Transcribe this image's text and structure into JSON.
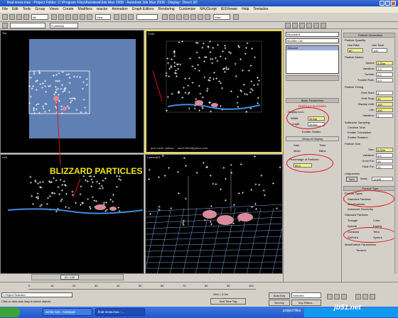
{
  "titlebar": {
    "text": "final-snow.max - Project Folder: C:\\Program Files\\Autodesk\\3ds Max 2008 - Autodesk 3ds Max 2008 - Display : Direct 3D"
  },
  "menubar": {
    "items": [
      "File",
      "Edit",
      "Tools",
      "Group",
      "Views",
      "Create",
      "Modifiers",
      "reactor",
      "Animation",
      "Graph Editors",
      "Rendering",
      "Customize",
      "MAXScript",
      "IESViewer",
      "Help",
      "Tentacles"
    ]
  },
  "toolbar": {
    "selection_filter": "All",
    "view_combo": "View",
    "named_sel": "0 (default)"
  },
  "viewports": {
    "top": {
      "label": "Top"
    },
    "front": {
      "label": "Front"
    },
    "left": {
      "label": "Left"
    },
    "camera": {
      "label": "Camera01"
    },
    "front_credit": "arch coral...pdisco...  .samt.2002@yahoo.com"
  },
  "overlay": {
    "title": "BLIZZARD PARTICLES"
  },
  "panel": {
    "object_name": "Blizzard01",
    "modifier_list": "Modifier List",
    "stack_item": "Blizzard",
    "basic_params": "Basic Parameters",
    "basic_title": "PARTICLE BLIZZARD",
    "display_icon": "Display Icon:",
    "width_label": "Width:",
    "width_val": "26.6m",
    "length_label": "Length:",
    "length_val": "26.6m",
    "emitter_hidden": "Emitter Hidden",
    "viewport_display": "Viewport Display",
    "dots": "Dots",
    "ticks": "Ticks",
    "mesh": "Mesh",
    "bbox": "BBox",
    "pct_label": "Percentage of Particles:",
    "pct_val": "50.0"
  },
  "panel2": {
    "particle_generation": "Particle Generation",
    "particle_quantity": "Particle Quantity",
    "use_rate": "Use Rate",
    "use_total": "Use Total",
    "rate_val": "80",
    "total_val": "100",
    "particle_motion": "Particle Motion",
    "speed": "Speed:",
    "speed_val": "0.25m",
    "variation": "Variation:",
    "variation_val": "2.0",
    "tumble": "Tumble:",
    "tumble_val": "0.0",
    "tumble_rate": "Tumble Rate:",
    "tumble_rate_val": "0.0",
    "particle_timing": "Particle Timing",
    "emit_start": "Emit Start:",
    "emit_start_val": "0",
    "emit_stop": "Emit Stop:",
    "emit_stop_val": "30",
    "display_until": "Display Until:",
    "display_until_val": "100",
    "life": "Life:",
    "life_val": "100",
    "var2": "Variation:",
    "var2_val": "0",
    "subframe": "Subframe Sampling:",
    "creation_time": "Creation Time",
    "emitter_translation": "Emitter Translation",
    "emitter_rotation": "Emitter Rotation",
    "particle_size": "Particle Size",
    "size": "Size:",
    "size_val": "0.02m",
    "var3": "Variation:",
    "var3_val": "0.0",
    "grow_for": "Grow For:",
    "grow_for_val": "10",
    "fade_for": "Fade For:",
    "fade_for_val": "10",
    "uniqueness": "Uniqueness",
    "new": "New",
    "seed": "Seed:",
    "seed_val": "12345",
    "particle_type": "Particle Type",
    "particle_types": "Particle Types",
    "standard": "Standard Particles",
    "metaparticles": "MetaParticles",
    "instanced": "Instanced Geometry",
    "standard_particles": "Standard Particles",
    "triangle": "Triangle",
    "cube": "Cube",
    "special": "Special",
    "facing": "Facing",
    "constant": "Constant",
    "tetra": "Tetra",
    "sixpoint": "SixPoint",
    "sphere": "Sphere",
    "meta_params": "MetaParticle Parameters",
    "tension": "Tension:"
  },
  "timeline": {
    "frame": "23 / 100",
    "ticks": [
      "0",
      "10",
      "20",
      "30",
      "40",
      "50",
      "60",
      "70",
      "80",
      "90",
      "100"
    ]
  },
  "status": {
    "selected": "1 Object Selected",
    "prompt": "Click or click-and-drag to select objects",
    "grid": "Grid = 0.0m",
    "add_time_tag": "Add Time Tag",
    "auto_key": "Auto Key",
    "set_key": "Set Key",
    "selected_combo": "Selected",
    "key_filters": "Key Filters..."
  },
  "taskbar": {
    "tasks": [
      "winter tuts - Notepad",
      "final-snow.max - ..."
    ],
    "right": "project files",
    "watermark": "jb51.net"
  },
  "colors": {
    "accent": "#e8d84a",
    "circle": "#d8141e",
    "snow_plane": "#6a8ec8",
    "taskbar": "#2258c8"
  }
}
